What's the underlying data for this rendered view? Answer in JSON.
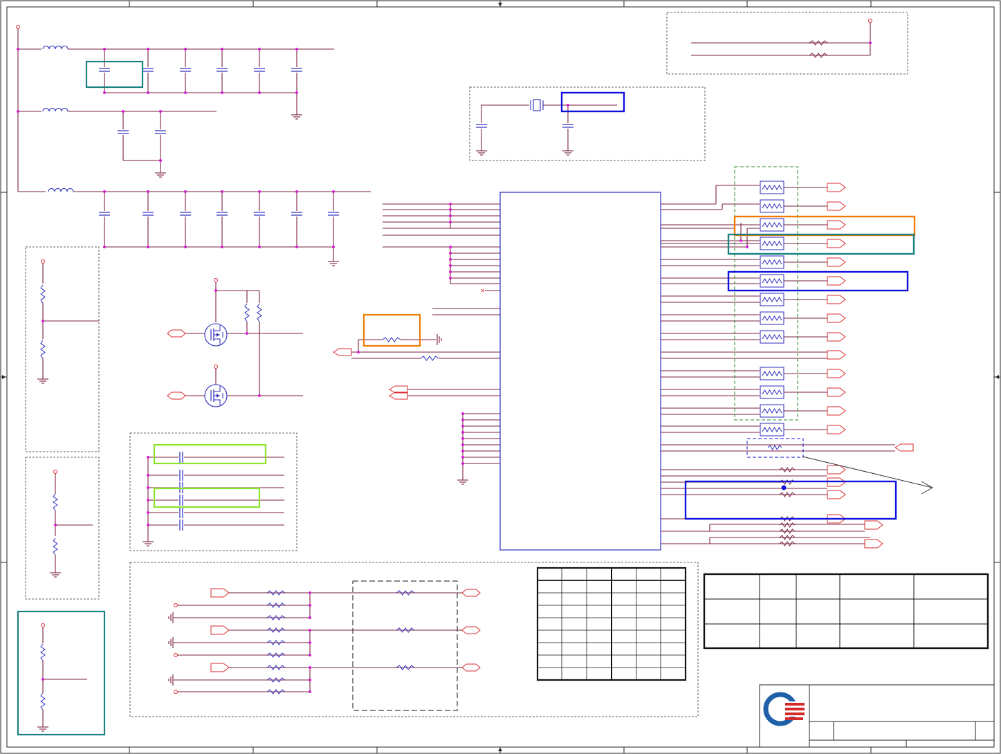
{
  "colors": {
    "background": "#ffffff",
    "wire": "#7a1f3d",
    "component": "#2b2bbf",
    "port": "#d8282d",
    "junction": "#d21fd2",
    "frame": "#222222",
    "highlight_teal": "#1a8080",
    "highlight_blue": "#1010dd",
    "highlight_orange": "#f07a00",
    "highlight_green": "#8ae42a",
    "group_green": "#2a8a2a",
    "logo_blue": "#1f5fa8",
    "logo_red": "#d42a2a"
  },
  "icons": [
    "inductor-icon",
    "capacitor-icon",
    "resistor-icon",
    "ground-icon",
    "power-pin-icon",
    "crystal-icon",
    "mosfet-icon",
    "port-icon",
    "ferrite-bead-icon",
    "company-logo-icon"
  ]
}
